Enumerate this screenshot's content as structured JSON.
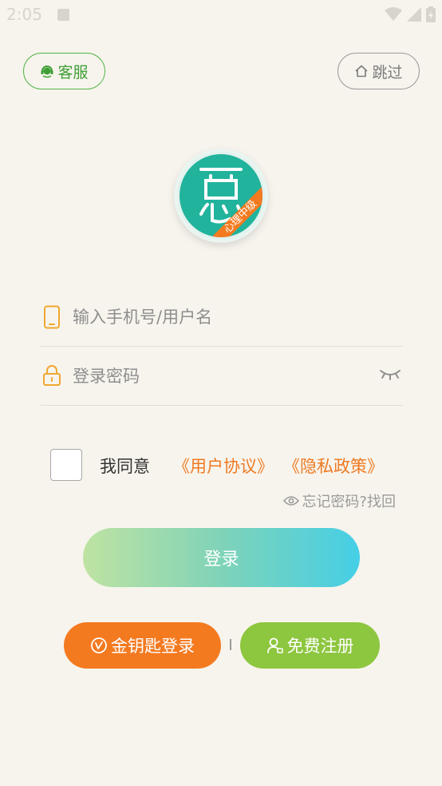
{
  "status_bar": {
    "time": "2:05"
  },
  "header": {
    "service_label": "客服",
    "skip_label": "跳过"
  },
  "logo": {
    "ribbon_text": "心理中级"
  },
  "form": {
    "phone_placeholder": "输入手机号/用户名",
    "password_placeholder": "登录密码"
  },
  "agreement": {
    "prefix": "我同意",
    "user_agreement": "《用户协议》",
    "privacy_policy": "《隐私政策》",
    "checked": false
  },
  "forgot_password": "忘记密码?找回",
  "login_label": "登录",
  "bottom": {
    "golden_key_label": "金钥匙登录",
    "register_label": "免费注册"
  },
  "colors": {
    "background": "#f7f4ed",
    "service_green": "#54b548",
    "accent_orange": "#ee7a22",
    "golden_btn": "#f47a20",
    "register_btn": "#8dc63f",
    "logo_teal": "#21b39c",
    "login_gradient_start": "#bfe3a2",
    "login_gradient_end": "#45cfe6"
  },
  "icons": {
    "service": "headset-icon",
    "skip": "home-icon",
    "phone": "phone-icon",
    "password": "lock-icon",
    "visibility": "eye-closed-icon",
    "forgot": "eye-icon",
    "golden_key": "key-icon",
    "register": "user-add-icon"
  }
}
